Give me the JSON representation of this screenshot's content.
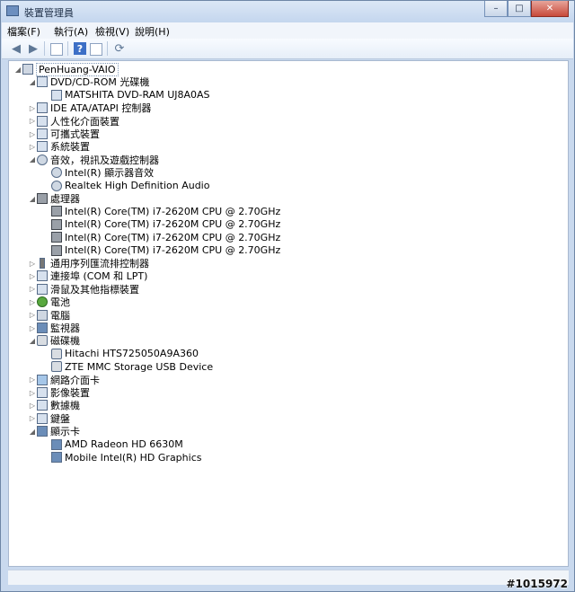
{
  "window": {
    "title": "裝置管理員",
    "caption_buttons": {
      "minimize": "–",
      "maximize": "□",
      "close": "✕"
    }
  },
  "menu": [
    "檔案(F)",
    "執行(A)",
    "檢視(V)",
    "說明(H)"
  ],
  "toolbar": {
    "icons": [
      "back-icon",
      "forward-icon",
      "properties-icon",
      "help-icon",
      "console-tree-icon",
      "scan-hardware-icon"
    ]
  },
  "tree": {
    "root": "PenHuang-VAIO",
    "rows": [
      {
        "label": "DVD/CD-ROM 光碟機",
        "level": 1,
        "expanded": true,
        "icon": "dvd-drive-icon"
      },
      {
        "label": "MATSHITA DVD-RAM UJ8A0AS",
        "level": 2,
        "icon": "dvd-drive-icon"
      },
      {
        "label": "IDE ATA/ATAPI 控制器",
        "level": 1,
        "expanded": false,
        "icon": "ide-controller-icon"
      },
      {
        "label": "人性化介面裝置",
        "level": 1,
        "expanded": false,
        "icon": "hid-icon"
      },
      {
        "label": "可攜式裝置",
        "level": 1,
        "expanded": false,
        "icon": "portable-device-icon"
      },
      {
        "label": "系統裝置",
        "level": 1,
        "expanded": false,
        "icon": "system-device-icon"
      },
      {
        "label": "音效，視訊及遊戲控制器",
        "level": 1,
        "expanded": true,
        "icon": "audio-icon"
      },
      {
        "label": "Intel(R) 顯示器音效",
        "level": 2,
        "icon": "audio-icon"
      },
      {
        "label": "Realtek High Definition Audio",
        "level": 2,
        "icon": "audio-icon"
      },
      {
        "label": "處理器",
        "level": 1,
        "expanded": true,
        "icon": "processor-icon"
      },
      {
        "label": "Intel(R) Core(TM) i7-2620M CPU @ 2.70GHz",
        "level": 2,
        "icon": "processor-icon"
      },
      {
        "label": "Intel(R) Core(TM) i7-2620M CPU @ 2.70GHz",
        "level": 2,
        "icon": "processor-icon"
      },
      {
        "label": "Intel(R) Core(TM) i7-2620M CPU @ 2.70GHz",
        "level": 2,
        "icon": "processor-icon"
      },
      {
        "label": "Intel(R) Core(TM) i7-2620M CPU @ 2.70GHz",
        "level": 2,
        "icon": "processor-icon"
      },
      {
        "label": "通用序列匯流排控制器",
        "level": 1,
        "expanded": false,
        "icon": "usb-icon"
      },
      {
        "label": "連接埠 (COM 和 LPT)",
        "level": 1,
        "expanded": false,
        "icon": "port-icon"
      },
      {
        "label": "滑鼠及其他指標裝置",
        "level": 1,
        "expanded": false,
        "icon": "mouse-icon"
      },
      {
        "label": "電池",
        "level": 1,
        "expanded": false,
        "icon": "battery-icon"
      },
      {
        "label": "電腦",
        "level": 1,
        "expanded": false,
        "icon": "computer-icon"
      },
      {
        "label": "監視器",
        "level": 1,
        "expanded": false,
        "icon": "monitor-icon"
      },
      {
        "label": "磁碟機",
        "level": 1,
        "expanded": true,
        "icon": "disk-drive-icon"
      },
      {
        "label": "Hitachi HTS725050A9A360",
        "level": 2,
        "icon": "disk-drive-icon"
      },
      {
        "label": "ZTE MMC Storage USB Device",
        "level": 2,
        "icon": "disk-drive-icon"
      },
      {
        "label": "網路介面卡",
        "level": 1,
        "expanded": false,
        "icon": "network-adapter-icon"
      },
      {
        "label": "影像裝置",
        "level": 1,
        "expanded": false,
        "icon": "imaging-device-icon"
      },
      {
        "label": "數據機",
        "level": 1,
        "expanded": false,
        "icon": "modem-icon"
      },
      {
        "label": "鍵盤",
        "level": 1,
        "expanded": false,
        "icon": "keyboard-icon"
      },
      {
        "label": "顯示卡",
        "level": 1,
        "expanded": true,
        "icon": "display-adapter-icon"
      },
      {
        "label": "AMD Radeon HD 6630M",
        "level": 2,
        "icon": "display-adapter-icon"
      },
      {
        "label": "Mobile Intel(R) HD Graphics",
        "level": 2,
        "icon": "display-adapter-icon"
      }
    ]
  },
  "watermark": "#1015972"
}
